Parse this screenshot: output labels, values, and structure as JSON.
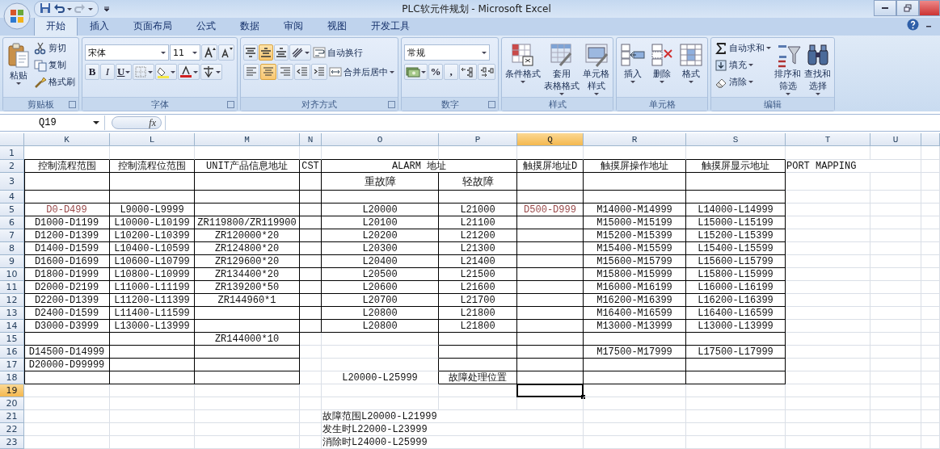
{
  "title_bar": {
    "title": "PLC软元件规划 - Microsoft Excel"
  },
  "tabs": [
    {
      "label": "开始",
      "selected": true
    },
    {
      "label": "插入",
      "selected": false
    },
    {
      "label": "页面布局",
      "selected": false
    },
    {
      "label": "公式",
      "selected": false
    },
    {
      "label": "数据",
      "selected": false
    },
    {
      "label": "审阅",
      "selected": false
    },
    {
      "label": "视图",
      "selected": false
    },
    {
      "label": "开发工具",
      "selected": false
    }
  ],
  "ribbon": [
    {
      "label": "剪贴板",
      "launcher": true,
      "items": [
        {
          "kind": "paste",
          "label": "粘贴"
        },
        {
          "kind": "cut",
          "label": "剪切"
        },
        {
          "kind": "copy",
          "label": "复制"
        },
        {
          "kind": "brush",
          "label": "格式刷"
        }
      ]
    },
    {
      "label": "字体",
      "launcher": true,
      "rows": [
        [
          {
            "kind": "fontbox",
            "value": "宋体"
          },
          {
            "kind": "sizebox",
            "value": "11"
          },
          {
            "kind": "grow"
          },
          {
            "kind": "shrink"
          }
        ],
        [
          {
            "kind": "bold",
            "label": "B"
          },
          {
            "kind": "italic",
            "label": "I"
          },
          {
            "kind": "underline",
            "label": "U"
          },
          {
            "kind": "borders"
          },
          {
            "kind": "fill"
          },
          {
            "kind": "fontcolor"
          },
          {
            "kind": "phonetic"
          }
        ]
      ]
    },
    {
      "label": "对齐方式",
      "launcher": true,
      "rows": [
        [
          {
            "kind": "aligntop",
            "selected": false
          },
          {
            "kind": "alignmid",
            "selected": true
          },
          {
            "kind": "alignbot",
            "selected": false
          },
          {
            "kind": "orient"
          },
          {
            "kind": "wrap",
            "label": "自动换行"
          }
        ],
        [
          {
            "kind": "alignleft",
            "selected": false
          },
          {
            "kind": "aligncenter",
            "selected": true
          },
          {
            "kind": "alignright",
            "selected": false
          },
          {
            "kind": "outdent"
          },
          {
            "kind": "indent"
          },
          {
            "kind": "merge",
            "label": "合并后居中"
          }
        ]
      ]
    },
    {
      "label": "数字",
      "launcher": true,
      "rows": [
        [
          {
            "kind": "formatbox",
            "value": "常规"
          }
        ],
        [
          {
            "kind": "currency"
          },
          {
            "kind": "percent",
            "label": "%"
          },
          {
            "kind": "comma",
            "label": ","
          },
          {
            "kind": "incdec"
          },
          {
            "kind": "decdec"
          }
        ]
      ]
    },
    {
      "label": "样式",
      "launcher": false,
      "items": [
        {
          "kind": "cond",
          "label": "条件格式"
        },
        {
          "kind": "tablefmt",
          "lines": [
            "套用",
            "表格格式"
          ]
        },
        {
          "kind": "cellstyle",
          "lines": [
            "单元格",
            "样式"
          ]
        }
      ]
    },
    {
      "label": "单元格",
      "launcher": false,
      "items": [
        {
          "kind": "insert",
          "label": "插入"
        },
        {
          "kind": "delete",
          "label": "删除"
        },
        {
          "kind": "format",
          "label": "格式"
        }
      ]
    },
    {
      "label": "编辑",
      "launcher": false,
      "items": [
        {
          "kind": "autosum",
          "label": "自动求和"
        },
        {
          "kind": "filldown",
          "label": "填充"
        },
        {
          "kind": "clear",
          "label": "清除"
        },
        {
          "kind": "sort",
          "lines": [
            "排序和",
            "筛选"
          ]
        },
        {
          "kind": "find",
          "lines": [
            "查找和",
            "选择"
          ]
        }
      ]
    }
  ],
  "formula_bar": {
    "name_box": "Q19",
    "fx": "fx"
  },
  "sheet": {
    "columns": [
      {
        "label": "K",
        "selected": false
      },
      {
        "label": "L",
        "selected": false
      },
      {
        "label": "M",
        "selected": false
      },
      {
        "label": "N",
        "selected": false
      },
      {
        "label": "O",
        "selected": false
      },
      {
        "label": "P",
        "selected": false
      },
      {
        "label": "Q",
        "selected": true
      },
      {
        "label": "R",
        "selected": false
      },
      {
        "label": "S",
        "selected": false
      },
      {
        "label": "T",
        "selected": false
      },
      {
        "label": "U",
        "selected": false
      }
    ],
    "rows": [
      {
        "number": "1",
        "selected": false,
        "cells": []
      },
      {
        "number": "2",
        "selected": false,
        "cells": [
          {
            "text": "控制流程范围"
          },
          {
            "text": "控制流程位范围"
          },
          {
            "text": "UNIT产品信息地址"
          },
          {
            "text": "CST"
          },
          {
            "text": "ALARM 地址",
            "merged": true
          },
          {},
          {
            "text": "触摸屏地址D"
          },
          {
            "text": "触摸屏操作地址"
          },
          {
            "text": "触摸屏显示地址"
          },
          {
            "text": "PORT MAPPING"
          }
        ]
      },
      {
        "number": "3",
        "selected": false,
        "cells": [
          {},
          {},
          {},
          {},
          {
            "text": "重故障"
          },
          {
            "text": "轻故障"
          }
        ]
      },
      {
        "number": "4",
        "selected": false,
        "cells": []
      },
      {
        "number": "5",
        "selected": false,
        "cells": [
          {
            "text": "D0-D499",
            "color": "#9a4a4a"
          },
          {
            "text": "L9000-L9999"
          },
          {},
          {},
          {
            "text": "L20000"
          },
          {
            "text": "L21000"
          },
          {
            "text": "D500-D999",
            "color": "#9a4a4a"
          },
          {
            "text": "M14000-M14999"
          },
          {
            "text": "L14000-L14999"
          }
        ]
      },
      {
        "number": "6",
        "selected": false,
        "cells": [
          {
            "text": "D1000-D1199"
          },
          {
            "text": "L10000-L10199"
          },
          {
            "text": "ZR119800/ZR119900"
          },
          {},
          {
            "text": "L20100"
          },
          {
            "text": "L21100"
          },
          {},
          {
            "text": "M15000-M15199"
          },
          {
            "text": "L15000-L15199"
          }
        ]
      },
      {
        "number": "7",
        "selected": false,
        "cells": [
          {
            "text": "D1200-D1399"
          },
          {
            "text": "L10200-L10399"
          },
          {
            "text": "ZR120000*20"
          },
          {},
          {
            "text": "L20200"
          },
          {
            "text": "L21200"
          },
          {},
          {
            "text": "M15200-M15399"
          },
          {
            "text": "L15200-L15399"
          }
        ]
      },
      {
        "number": "8",
        "selected": false,
        "cells": [
          {
            "text": "D1400-D1599"
          },
          {
            "text": "L10400-L10599"
          },
          {
            "text": "ZR124800*20"
          },
          {},
          {
            "text": "L20300"
          },
          {
            "text": "L21300"
          },
          {},
          {
            "text": "M15400-M15599"
          },
          {
            "text": "L15400-L15599"
          }
        ]
      },
      {
        "number": "9",
        "selected": false,
        "cells": [
          {
            "text": "D1600-D1699"
          },
          {
            "text": "L10600-L10799"
          },
          {
            "text": "ZR129600*20"
          },
          {},
          {
            "text": "L20400"
          },
          {
            "text": "L21400"
          },
          {},
          {
            "text": "M15600-M15799"
          },
          {
            "text": "L15600-L15799"
          }
        ]
      },
      {
        "number": "10",
        "selected": false,
        "cells": [
          {
            "text": "D1800-D1999"
          },
          {
            "text": "L10800-L10999"
          },
          {
            "text": "ZR134400*20"
          },
          {},
          {
            "text": "L20500"
          },
          {
            "text": "L21500"
          },
          {},
          {
            "text": "M15800-M15999"
          },
          {
            "text": "L15800-L15999"
          }
        ]
      },
      {
        "number": "11",
        "selected": false,
        "cells": [
          {
            "text": "D2000-D2199"
          },
          {
            "text": "L11000-L11199"
          },
          {
            "text": "ZR139200*50"
          },
          {},
          {
            "text": "L20600"
          },
          {
            "text": "L21600"
          },
          {},
          {
            "text": "M16000-M16199"
          },
          {
            "text": "L16000-L16199"
          }
        ]
      },
      {
        "number": "12",
        "selected": false,
        "cells": [
          {
            "text": "D2200-D1399"
          },
          {
            "text": "L11200-L11399"
          },
          {
            "text": "ZR144960*1"
          },
          {},
          {
            "text": "L20700"
          },
          {
            "text": "L21700"
          },
          {},
          {
            "text": "M16200-M16399"
          },
          {
            "text": "L16200-L16399"
          }
        ]
      },
      {
        "number": "13",
        "selected": false,
        "cells": [
          {
            "text": "D2400-D1599"
          },
          {
            "text": "L11400-L11599"
          },
          {},
          {},
          {
            "text": "L20800"
          },
          {
            "text": "L21800"
          },
          {},
          {
            "text": "M16400-M16599"
          },
          {
            "text": "L16400-L16599"
          }
        ]
      },
      {
        "number": "14",
        "selected": false,
        "cells": [
          {
            "text": "D3000-D3999"
          },
          {
            "text": "L13000-L13999"
          },
          {},
          {},
          {
            "text": "L20800"
          },
          {
            "text": "L21800"
          },
          {},
          {
            "text": "M13000-M13999"
          },
          {
            "text": "L13000-L13999"
          }
        ]
      },
      {
        "number": "15",
        "selected": false,
        "cells": [
          {},
          {},
          {
            "text": "ZR144000*10"
          }
        ]
      },
      {
        "number": "16",
        "selected": false,
        "cells": [
          {
            "text": "D14500-D14999"
          },
          {},
          {},
          {},
          {},
          {},
          {},
          {
            "text": "M17500-M17999"
          },
          {
            "text": "L17500-L17999"
          }
        ]
      },
      {
        "number": "17",
        "selected": false,
        "cells": [
          {
            "text": "D20000-D99999"
          }
        ]
      },
      {
        "number": "18",
        "selected": false,
        "cells": [
          {},
          {},
          {},
          {},
          {
            "text": "L20000-L25999"
          },
          {
            "text": "故障处理位置"
          }
        ]
      },
      {
        "number": "19",
        "selected": true,
        "cells": []
      },
      {
        "number": "20",
        "selected": false,
        "cells": []
      },
      {
        "number": "21",
        "selected": false,
        "cells": [
          {},
          {},
          {},
          {},
          {
            "text": "故障范围L20000-L21999"
          }
        ]
      },
      {
        "number": "22",
        "selected": false,
        "cells": [
          {},
          {},
          {},
          {},
          {
            "text": "发生时L22000-L23999"
          }
        ]
      },
      {
        "number": "23",
        "selected": false,
        "cells": [
          {},
          {},
          {},
          {},
          {
            "text": "消除时L24000-L25999"
          }
        ]
      }
    ]
  }
}
